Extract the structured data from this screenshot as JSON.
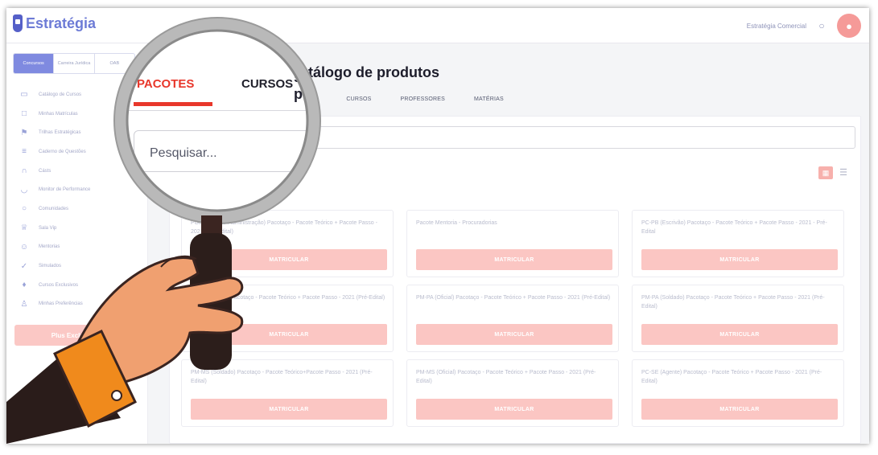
{
  "app": {
    "logo_text": "Estratégia",
    "store_name": "Estratégia Comercial"
  },
  "sidebar": {
    "tabs": [
      {
        "label": "Concursos",
        "active": true
      },
      {
        "label": "Carreira Jurídica",
        "active": false
      },
      {
        "label": "OAB",
        "active": false
      }
    ],
    "items": [
      {
        "label": "Catálogo de Cursos",
        "icon": "monitor-icon",
        "badge": false
      },
      {
        "label": "Minhas Matrículas",
        "icon": "tablet-icon",
        "badge": false
      },
      {
        "label": "Trilhas Estratégicas",
        "icon": "flag-icon",
        "badge": false
      },
      {
        "label": "Caderno de Questões",
        "icon": "list-icon",
        "badge": true
      },
      {
        "label": "Cásts",
        "icon": "headphones-icon",
        "badge": false
      },
      {
        "label": "Monitor de Performance",
        "icon": "gauge-icon",
        "badge": false
      },
      {
        "label": "Comunidades",
        "icon": "chat-icon",
        "badge": false
      },
      {
        "label": "Sala Vip",
        "icon": "crown-icon",
        "badge": false
      },
      {
        "label": "Mentorias",
        "icon": "users-icon",
        "badge": false
      },
      {
        "label": "Simulados",
        "icon": "check-circle-icon",
        "badge": false
      },
      {
        "label": "Cursos Exclusivos",
        "icon": "diamond-icon",
        "badge": false
      },
      {
        "label": "Minhas Preferências",
        "icon": "person-icon",
        "badge": true
      }
    ],
    "promo_button": "Plus Exclusivo"
  },
  "main": {
    "title": "Catálogo de produtos",
    "tabs": [
      "PACOTES",
      "CURSOS",
      "PROFESSORES",
      "MATÉRIAS"
    ],
    "search_placeholder": "Pesquisar...",
    "cards": [
      {
        "title": "PGE-(Técnico-Administração) Pacotaço - Pacote Teórico + Pacote Passo - 2021 (Pré-Edital)",
        "button": "MATRICULAR"
      },
      {
        "title": "Pacote Mentoria - Procuradorias",
        "button": "MATRICULAR"
      },
      {
        "title": "PC-PB (Escrivão) Pacotaço - Pacote Teórico + Pacote Passo - 2021 - Pré-Edital",
        "button": "MATRICULAR"
      },
      {
        "title": "PM-PA (Oficial) Pacotaço - Pacote Teórico + Pacote Passo - 2021 (Pré-Edital)",
        "button": "MATRICULAR"
      },
      {
        "title": "PM-PA (Oficial) Pacotaço - Pacote Teórico + Pacote Passo - 2021 (Pré-Edital)",
        "button": "MATRICULAR"
      },
      {
        "title": "PM-PA (Soldado) Pacotaço - Pacote Teórico + Pacote Passo - 2021 (Pré-Edital)",
        "button": "MATRICULAR"
      },
      {
        "title": "PM-MS (Soldado) Pacotaço - Pacote Teórico+Pacote Passo - 2021 (Pré-Edital)",
        "button": "MATRICULAR"
      },
      {
        "title": "PM-MS (Oficial) Pacotaço - Pacote Teórico + Pacote Passo - 2021 (Pré-Edital)",
        "button": "MATRICULAR"
      },
      {
        "title": "PC-SE (Agente) Pacotaço - Pacote Teórico + Pacote Passo - 2021 (Pré-Edital)",
        "button": "MATRICULAR"
      }
    ]
  },
  "lens": {
    "tab_active": "PACOTES",
    "tab_other": "CURSOS",
    "title_fragment": "s produtos",
    "search_placeholder": "Pesquisar..."
  },
  "colors": {
    "accent": "#e8372b",
    "brand": "#6d7bd6",
    "button_pink": "#fbc6c3",
    "hand_skin": "#f0a070",
    "cuff_orange": "#f08a1c"
  }
}
